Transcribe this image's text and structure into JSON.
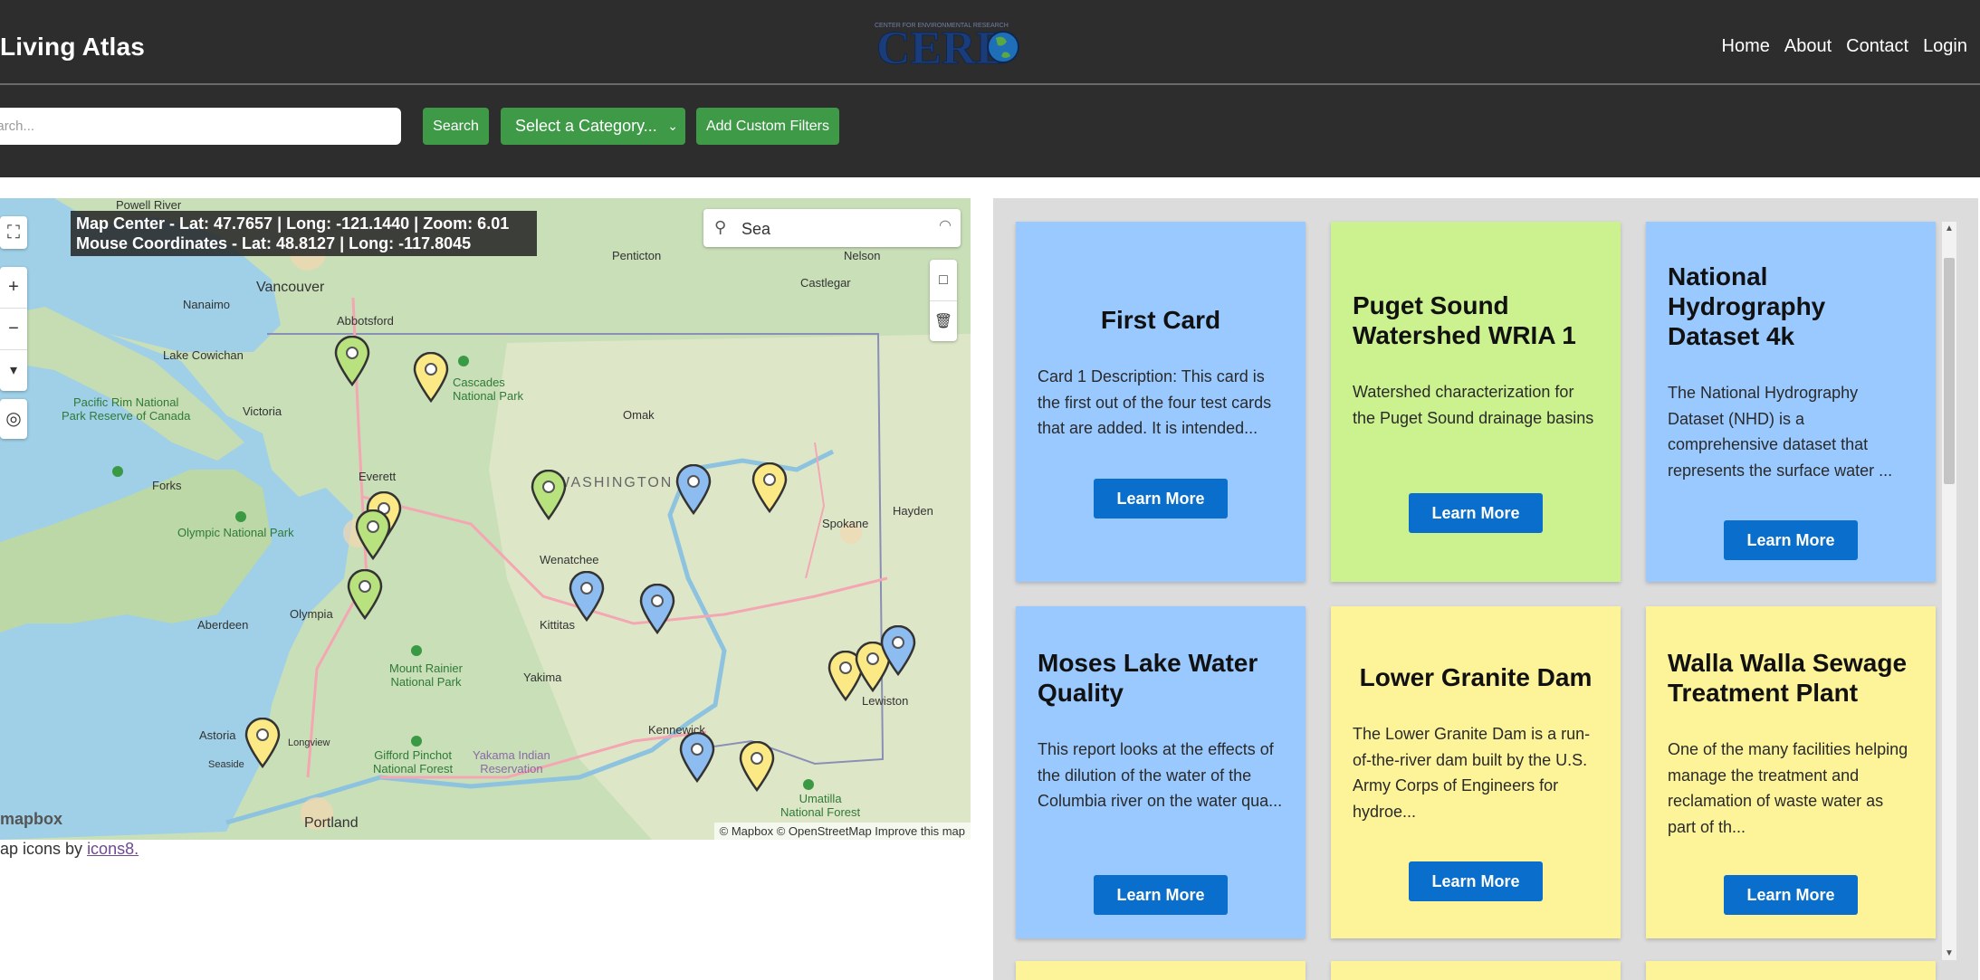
{
  "header": {
    "brand": "Living Atlas",
    "logo_text": "CEREO",
    "nav": [
      "Home",
      "About",
      "Contact",
      "Login"
    ]
  },
  "toolbar": {
    "search_placeholder": "Search...",
    "search_label": "Search",
    "category_label": "Select a Category...",
    "filters_label": "Add Custom Filters"
  },
  "map": {
    "center_readout": "Map Center - Lat: 47.7657 | Long: -121.1440 | Zoom: 6.01",
    "mouse_readout": "Mouse Coordinates - Lat: 48.8127 | Long: -117.8045",
    "search_value": "Sea",
    "brand": "mapbox",
    "attribution": "© Mapbox © OpenStreetMap  Improve this map",
    "labels": {
      "powell_river": "Powell River",
      "vancouver": "Vancouver",
      "nanaimo": "Nanaimo",
      "abbotsford": "Abbotsford",
      "lake_cowichan": "Lake Cowichan",
      "victoria": "Victoria",
      "pacific_rim": "Pacific Rim National\nPark Reserve of Canada",
      "cascades": "Cascades\nNational Park",
      "omak": "Omak",
      "penticton": "Penticton",
      "castlegar": "Castlegar",
      "nelson": "Nelson",
      "washington": "WASHINGTON",
      "everett": "Everett",
      "forks": "Forks",
      "olympic": "Olympic National Park",
      "spokane": "Spokane",
      "hayden": "Hayden",
      "wenatchee": "Wenatchee",
      "aberdeen": "Aberdeen",
      "olympia": "Olympia",
      "kittitas": "Kittitas",
      "mount_rainier": "Mount Rainier\nNational Park",
      "yakima": "Yakima",
      "lewiston": "Lewiston",
      "astoria": "Astoria",
      "longview": "Longview",
      "seaside": "Seaside",
      "kennewick": "Kennewick",
      "gifford": "Gifford Pinchot\nNational Forest",
      "yakama": "Yakama Indian\nReservation",
      "umatilla": "Umatilla\nNational Forest",
      "portland": "Portland"
    },
    "credit_prefix": "ap icons by ",
    "credit_link": "icons8."
  },
  "cards": [
    {
      "title": "First Card",
      "description": "Card 1 Description: This card is the first out of the four test cards that are added. It is intended...",
      "button": "Learn More",
      "color": "blue"
    },
    {
      "title": "Puget Sound Watershed WRIA 1",
      "description": "Watershed characterization for the Puget Sound drainage basins",
      "button": "Learn More",
      "color": "green"
    },
    {
      "title": "National Hydrography Dataset 4k",
      "description": "The National Hydrography Dataset (NHD) is a comprehensive dataset that represents the surface water ...",
      "button": "Learn More",
      "color": "blue"
    },
    {
      "title": "Moses Lake Water Quality",
      "description": "This report looks at the effects of the dilution of the water of the Columbia river on the water qua...",
      "button": "Learn More",
      "color": "blue"
    },
    {
      "title": "Lower Granite Dam",
      "description": "The Lower Granite Dam is a run-of-the-river dam built by the U.S. Army Corps of Engineers for hydroe...",
      "button": "Learn More",
      "color": "yellow"
    },
    {
      "title": "Walla Walla Sewage Treatment Plant",
      "description": "One of the many facilities helping manage the treatment and reclamation of waste water as part of th...",
      "button": "Learn More",
      "color": "yellow"
    }
  ],
  "colors": {
    "header_bg": "#2d2d2d",
    "green_button": "#3f9a48",
    "learn_more": "#0a6ecc",
    "card_blue": "#99c9ff",
    "card_green": "#cbf28f",
    "card_yellow": "#fdf49a"
  },
  "icons": [
    "fullscreen-icon",
    "zoom-in-icon",
    "zoom-out-icon",
    "compass-icon",
    "geolocate-icon",
    "search-icon",
    "polygon-draw-icon",
    "trash-icon",
    "map-pin-icon",
    "chevron-down-icon"
  ]
}
